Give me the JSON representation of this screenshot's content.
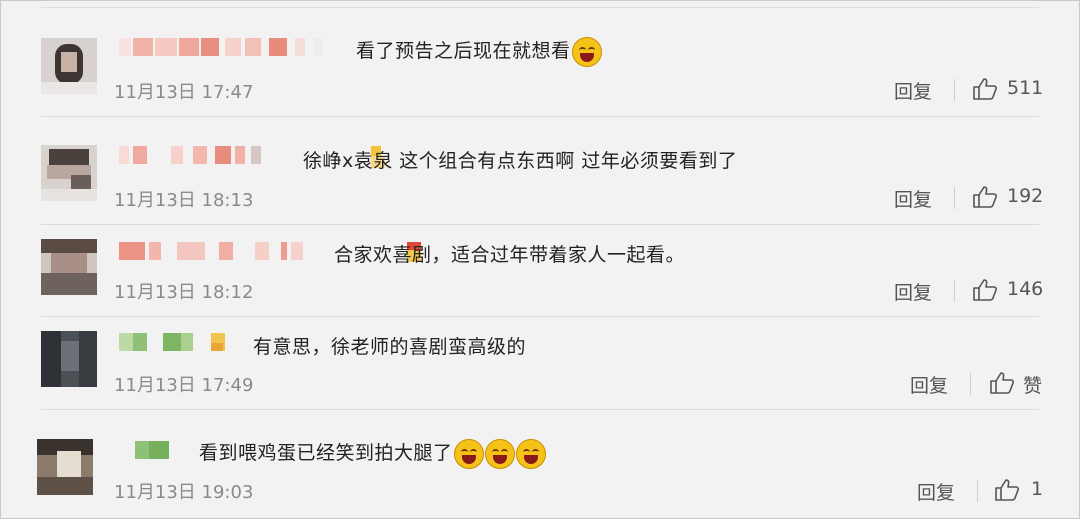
{
  "comments": [
    {
      "content": "看了预告之后现在就想看",
      "emoji_icon": "laugh-cry-emoji-icon",
      "time": "11月13日 17:47",
      "reply": "回复",
      "likes": "511"
    },
    {
      "content": "徐峥x袁泉 这个组合有点东西啊   过年必须要看到了",
      "time": "11月13日 18:13",
      "reply": "回复",
      "likes": "192"
    },
    {
      "content": "合家欢喜剧，适合过年带着家人一起看。",
      "time": "11月13日 18:12",
      "reply": "回复",
      "likes": "146"
    },
    {
      "content": "有意思，徐老师的喜剧蛮高级的",
      "time": "11月13日 17:49",
      "reply": "回复",
      "likes": "赞"
    },
    {
      "content": "看到喂鸡蛋已经笑到拍大腿了",
      "emoji_icon": "laughing-emoji-icon",
      "time": "11月13日 19:03",
      "reply": "回复",
      "likes": "1"
    }
  ],
  "colors": {
    "background": "#f2f2f2",
    "text": "#222222",
    "meta": "#8a8a8a",
    "emoji": "#f5c21a"
  }
}
